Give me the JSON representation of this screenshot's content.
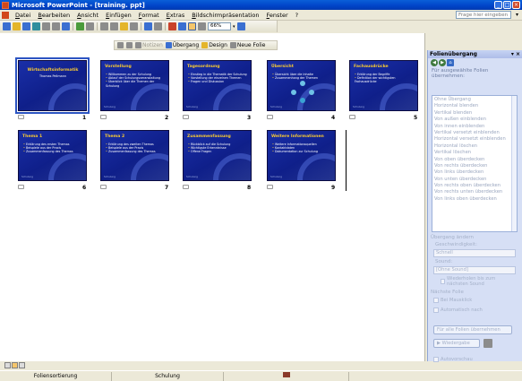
{
  "window": {
    "title": "Microsoft PowerPoint - [training. ppt]",
    "controls": [
      "_",
      "□",
      "×"
    ]
  },
  "menu": {
    "items": [
      "Datei",
      "Bearbeiten",
      "Ansicht",
      "Einfügen",
      "Format",
      "Extras",
      "Bildschirmpräsentation",
      "Fenster",
      "?"
    ],
    "help_placeholder": "Frage hier eingeben"
  },
  "toolbar": {
    "zoom": "66%"
  },
  "sorter_toolbar": {
    "notes_label": "Notizen",
    "transition_label": "Übergang",
    "design_label": "Design",
    "new_slide_label": "Neue Folie"
  },
  "slides": [
    {
      "number": "1",
      "title": "Wirtschaftsinformatik",
      "subtitle": "Thomas Pellmann",
      "bullets": [],
      "layout": "title",
      "footer": ""
    },
    {
      "number": "2",
      "title": "Vorstellung",
      "bullets": [
        "Willkommen zu der Schulung",
        "Ablauf der Schulungsveranstaltung",
        "Überblick über die Themen der Schulung"
      ],
      "layout": "bullets",
      "footer": "Schulung"
    },
    {
      "number": "3",
      "title": "Tagesordnung",
      "bullets": [
        "Einstieg in die Thematik der Schulung",
        "Vorstellung der einzelnen Themen",
        "Fragen und Diskussion"
      ],
      "layout": "bullets",
      "footer": "Schulung"
    },
    {
      "number": "4",
      "title": "Übersicht",
      "bullets": [
        "Übersicht über die Inhalte",
        "Zusammenhang der Themen"
      ],
      "layout": "art",
      "footer": "Schulung"
    },
    {
      "number": "5",
      "title": "Fachausdrücke",
      "bullets": [
        "Erklärung der Begriffe",
        "Definition der wichtigsten Fachausdrücke"
      ],
      "layout": "bullets",
      "footer": "Schulung"
    },
    {
      "number": "6",
      "title": "Thema 1",
      "bullets": [
        "Erklärung des ersten Themas",
        "Beispiele aus der Praxis",
        "Zusammenfassung des Themas"
      ],
      "layout": "bullets",
      "footer": "Schulung"
    },
    {
      "number": "7",
      "title": "Thema 2",
      "bullets": [
        "Erklärung des zweiten Themas",
        "Beispiele aus der Praxis",
        "Zusammenfassung des Themas"
      ],
      "layout": "bullets",
      "footer": "Schulung"
    },
    {
      "number": "8",
      "title": "Zusammenfassung",
      "bullets": [
        "Rückblick auf die Schulung",
        "Wichtigste Erkenntnisse",
        "Offene Fragen"
      ],
      "layout": "bullets",
      "footer": "Schulung"
    },
    {
      "number": "9",
      "title": "Weitere Informationen",
      "bullets": [
        "Weitere Informationsquellen",
        "Kontaktdaten",
        "Dokumentation zur Schulung"
      ],
      "layout": "bullets",
      "footer": "Schulung"
    }
  ],
  "taskpane": {
    "title": "Folienübergang",
    "section_apply": "Für ausgewählte Folien übernehmen:",
    "transitions": [
      "Ohne Übergang",
      "Horizontal blenden",
      "Vertikal blenden",
      "Von außen einblenden",
      "Von innen einblenden",
      "Vertikal versetzt einblenden",
      "Horizontal versetzt einblenden",
      "Horizontal löschen",
      "Vertikal löschen",
      "Von oben überdecken",
      "Von rechts überdecken",
      "Von links überdecken",
      "Von unten überdecken",
      "Von rechts oben überdecken",
      "Von rechts unten überdecken",
      "Von links oben überdecken"
    ],
    "section_modify": "Übergang ändern",
    "speed_label": "Geschwindigkeit:",
    "speed_value": "Schnell",
    "sound_label": "Sound:",
    "sound_value": "[Ohne Sound]",
    "loop_label": "Wiederholen bis zum nächsten Sound",
    "next_slide_label": "Nächste Folie",
    "on_click_label": "Bei Mausklick",
    "auto_label": "Automatisch nach",
    "apply_all_label": "Für alle Folien übernehmen",
    "play_label": "Wiedergabe",
    "autopreview_label": "Autovorschau"
  },
  "status": {
    "view": "Foliensortierung",
    "design": "Schulung"
  }
}
